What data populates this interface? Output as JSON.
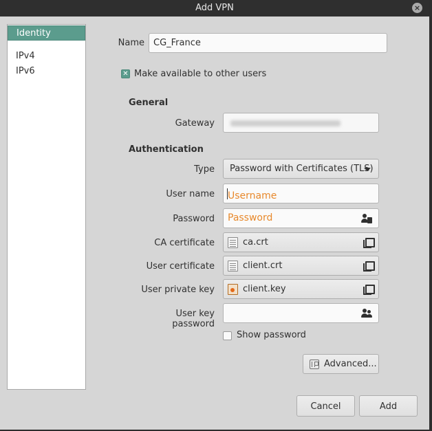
{
  "window": {
    "title": "Add VPN"
  },
  "sidebar": {
    "items": [
      {
        "label": "Identity",
        "selected": true
      },
      {
        "label": "IPv4",
        "selected": false
      },
      {
        "label": "IPv6",
        "selected": false
      }
    ]
  },
  "identity": {
    "name_label": "Name",
    "name_value": "CG_France",
    "share_label": "Make available to other users",
    "share_checked": true
  },
  "general": {
    "heading": "General",
    "gateway_label": "Gateway"
  },
  "auth": {
    "heading": "Authentication",
    "type_label": "Type",
    "type_value": "Password with Certificates (TLS)",
    "username_label": "User name",
    "username_placeholder": "Username",
    "password_label": "Password",
    "password_placeholder": "Password",
    "ca_label": "CA certificate",
    "ca_value": "ca.crt",
    "user_cert_label": "User certificate",
    "user_cert_value": "client.crt",
    "user_key_label": "User private key",
    "user_key_value": "client.key",
    "key_password_label": "User key password",
    "show_password_label": "Show password",
    "show_password_checked": false,
    "advanced_label": "Advanced..."
  },
  "footer": {
    "cancel_label": "Cancel",
    "add_label": "Add"
  },
  "colors": {
    "accent": "#5b9c8d",
    "placeholder": "#e8892c",
    "titlebar": "#2f2f2f",
    "background": "#d6d6d6"
  },
  "icons": [
    "close-icon",
    "checkmark-icon",
    "user-info-icon",
    "file-icon",
    "key-file-icon",
    "open-file-icon",
    "users-icon",
    "chevron-down-icon",
    "advanced-icon"
  ]
}
